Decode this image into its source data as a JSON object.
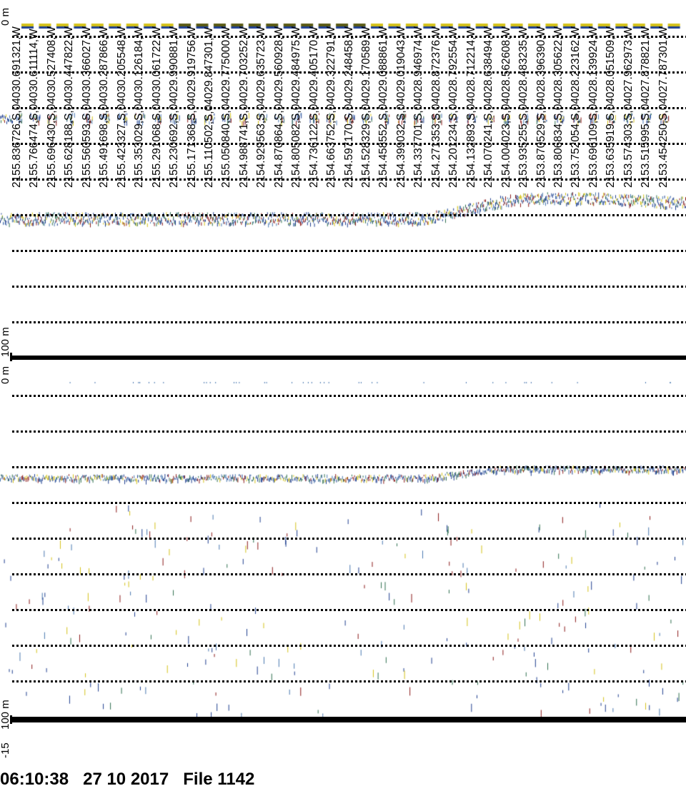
{
  "track_labels": [
    "2155.836726,S,04030.691321,W",
    "2155.766474,S,04030.611114,W",
    "2155.696430,S,04030.527408,W",
    "2155.628188,S,04030.447822,W",
    "2155.560593,S,04030.366027,W",
    "2155.491698,S,04030.287866,W",
    "2155.423327,S,04030.205548,W",
    "2155.353029,S,04030.126184,W",
    "2155.291068,S,04030.061722,W",
    "2155.230692,S,04029.990881,W",
    "2155.171368,S,04029.919756,W",
    "2155.110502,S,04029.847301,W",
    "2155.050840,S,04029.775000,W",
    "2154.988741,S,04029.703252,W",
    "2154.929563,S,04029.635723,W",
    "2154.870864,S,04029.560928,W",
    "2154.805082,S,04029.484975,W",
    "2154.736122,S,04029.405170,W",
    "2154.663752,S,04029.322791,W",
    "2154.597170,S,04029.248458,W",
    "2154.528329,S,04029.170589,W",
    "2154.458552,S,04029.088861,W",
    "2154.399032,S,04029.019043,W",
    "2154.337701,S,04028.946974,W",
    "2154.271353,S,04028.872376,W",
    "2154.201234,S,04028.792554,W",
    "2154.132893,S,04028.712214,W",
    "2154.070241,S,04028.638494,W",
    "2154.004023,S,04028.562608,W",
    "2153.935255,S,04028.483235,W",
    "2153.870529,S,04028.396390,W",
    "2153.806834,S,04028.305622,W",
    "2153.752054,S,04028.223162,W",
    "2153.696109,S,04028.139924,W",
    "2153.635919,S,04028.051509,W",
    "2153.574303,S,04027.962973,W",
    "2153.515995,S,04027.878821,W",
    "2153.454250,S,04027.787301,W"
  ],
  "upper_panel": {
    "top_label": "0 m",
    "bottom_label": "100 m"
  },
  "lower_panel": {
    "top_label": "0 m",
    "bottom_label": "100 m",
    "offset_label": "-15"
  },
  "footer": {
    "time": "06:10:38",
    "date": "27 10 2017",
    "file": "File 1142"
  },
  "colors": {
    "echo_strong": "#8b1a1a",
    "echo_yellow": "#d4c21a",
    "echo_olive": "#5a5a14",
    "echo_blue": "#1f3f8f",
    "echo_green": "#2f6f4f",
    "echo_lightblue": "#4a78b0"
  }
}
